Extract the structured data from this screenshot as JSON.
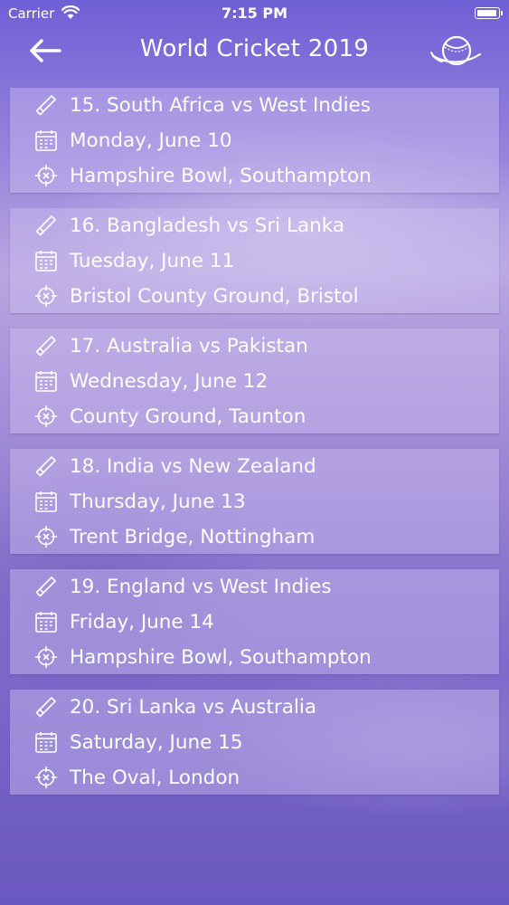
{
  "status_bar": {
    "carrier": "Carrier",
    "time": "7:15 PM",
    "battery_level": 1.0
  },
  "nav": {
    "title": "World Cricket 2019",
    "back_icon": "arrow-left-icon",
    "right_icon": "cricket-ball-icon"
  },
  "matches": [
    {
      "title": "15. South Africa vs West Indies",
      "date": "Monday, June 10",
      "venue": "Hampshire Bowl, Southampton"
    },
    {
      "title": "16. Bangladesh vs Sri Lanka",
      "date": "Tuesday, June 11",
      "venue": "Bristol County Ground, Bristol"
    },
    {
      "title": "17. Australia vs Pakistan",
      "date": "Wednesday, June 12",
      "venue": "County Ground, Taunton"
    },
    {
      "title": "18. India vs New Zealand",
      "date": "Thursday, June 13",
      "venue": "Trent Bridge, Nottingham"
    },
    {
      "title": "19. England vs West Indies",
      "date": "Friday, June 14",
      "venue": "Hampshire Bowl, Southampton"
    },
    {
      "title": "20. Sri Lanka vs Australia",
      "date": "Saturday, June 15",
      "venue": "The Oval, London"
    }
  ],
  "icons": {
    "match": "cricket-bat-icon",
    "date": "calendar-icon",
    "venue": "location-target-icon"
  },
  "colors": {
    "text": "#ffffff",
    "background": "#8a74d2",
    "card": "#cdbef0"
  }
}
